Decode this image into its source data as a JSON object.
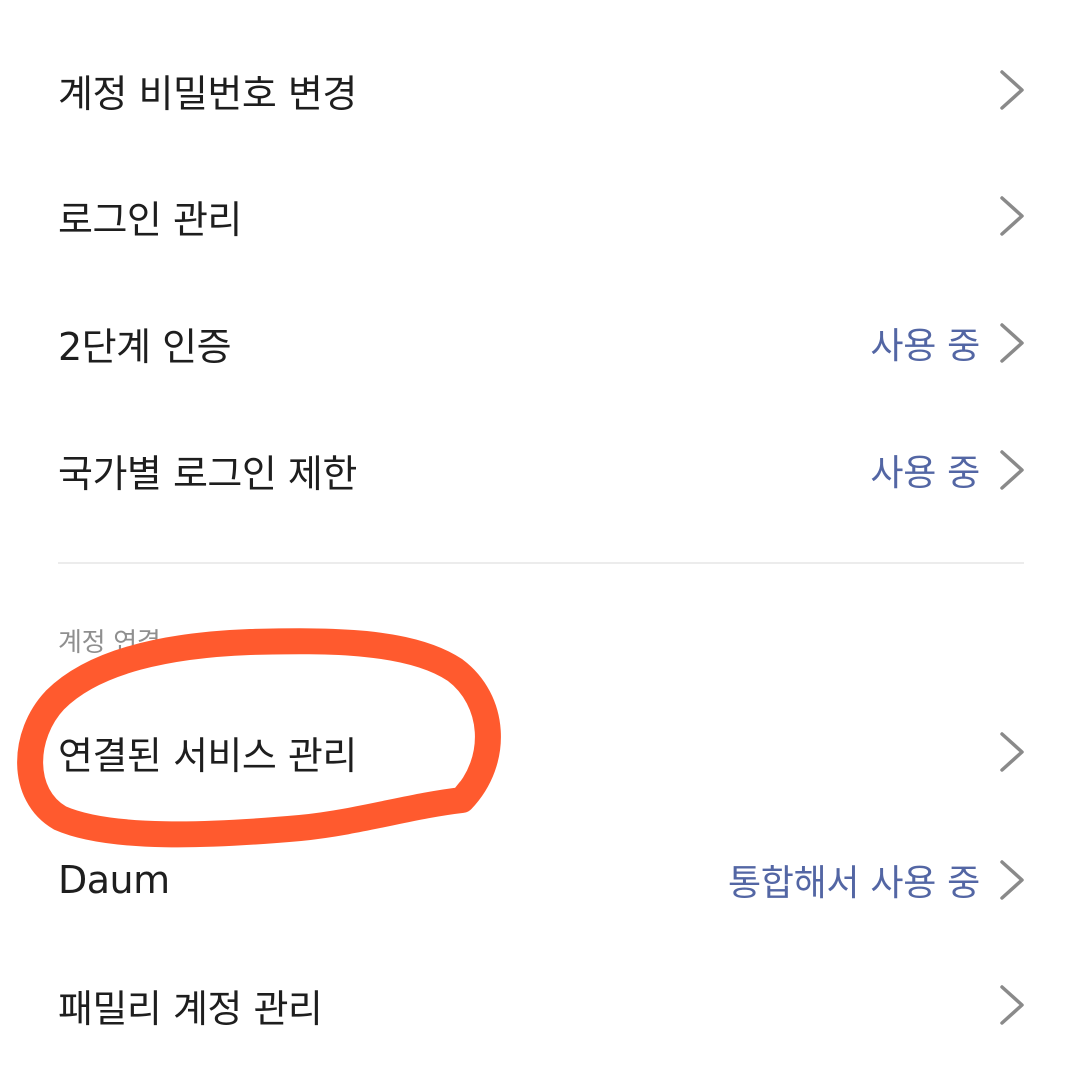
{
  "security_items": [
    {
      "label": "계정 비밀번호 변경",
      "status": ""
    },
    {
      "label": "로그인 관리",
      "status": ""
    },
    {
      "label": "2단계 인증",
      "status": "사용 중"
    },
    {
      "label": "국가별 로그인 제한",
      "status": "사용 중"
    }
  ],
  "account_link_section": {
    "title": "계정 연결",
    "items": [
      {
        "label": "연결된 서비스 관리",
        "status": ""
      },
      {
        "label": "Daum",
        "status": "통합해서 사용 중"
      },
      {
        "label": "패밀리 계정 관리",
        "status": ""
      }
    ]
  },
  "colors": {
    "status_text": "#5366a4",
    "annotation_circle": "#ff5a2e",
    "chevron": "#8a8a8a"
  },
  "icons": {
    "row_arrow": "chevron-right-icon"
  }
}
